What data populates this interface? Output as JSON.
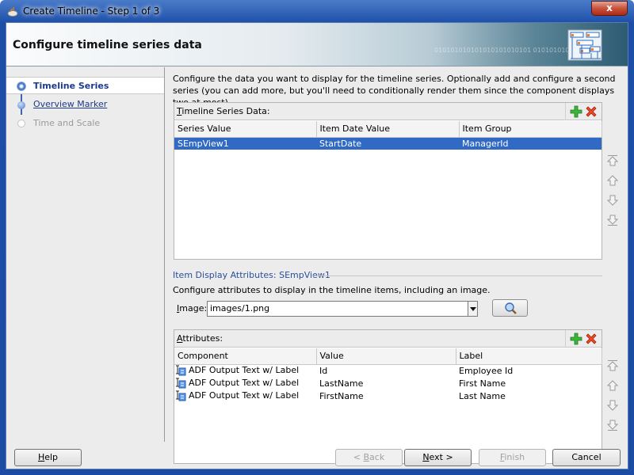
{
  "window": {
    "title": "Create Timeline - Step 1 of 3",
    "close_label": "x"
  },
  "banner": {
    "heading": "Configure timeline series data",
    "binary_text": "010101010101010101010101 0101010101"
  },
  "steps": [
    {
      "label": "Timeline Series",
      "state": "active"
    },
    {
      "label": "Overview Marker",
      "state": "link"
    },
    {
      "label": "Time and Scale",
      "state": "disabled"
    }
  ],
  "main": {
    "description": "Configure the data you want to display for the timeline series. Optionally add and configure a second series (you can add more, but you'll need to conditionally render them since the component displays two at most).",
    "series_panel": {
      "label_mnemonic": "T",
      "label_rest": "imeline Series Data:",
      "columns": [
        "Series Value",
        "Item Date Value",
        "Item Group"
      ],
      "rows": [
        {
          "series_value": "SEmpView1",
          "item_date_value": "StartDate",
          "item_group": "ManagerId",
          "selected": true
        }
      ]
    },
    "item_display": {
      "section_label": "Item Display Attributes: SEmpView1",
      "description": "Configure attributes to display in the timeline items, including an image.",
      "image_label_mnemonic": "I",
      "image_label_rest": "mage:",
      "image_value": "images/1.png"
    },
    "attributes_panel": {
      "label_mnemonic": "A",
      "label_rest": "ttributes:",
      "columns": [
        "Component",
        "Value",
        "Label"
      ],
      "rows": [
        {
          "component": "ADF Output Text w/ Label",
          "value": "Id",
          "label": "Employee Id"
        },
        {
          "component": "ADF Output Text w/ Label",
          "value": "LastName",
          "label": "First Name"
        },
        {
          "component": "ADF Output Text w/ Label",
          "value": "FirstName",
          "label": "Last Name"
        }
      ]
    }
  },
  "footer": {
    "help": {
      "mnemonic": "H",
      "rest": "elp"
    },
    "back": {
      "pre": "< ",
      "mnemonic": "B",
      "rest": "ack",
      "enabled": false
    },
    "next": {
      "mnemonic": "N",
      "rest": "ext >",
      "enabled": true
    },
    "finish": {
      "mnemonic": "F",
      "rest": "inish",
      "enabled": false
    },
    "cancel": {
      "label": "Cancel",
      "enabled": true
    }
  },
  "colors": {
    "selection": "#316ac5",
    "link": "#1d3a8a",
    "section_label": "#2a4f9c"
  }
}
